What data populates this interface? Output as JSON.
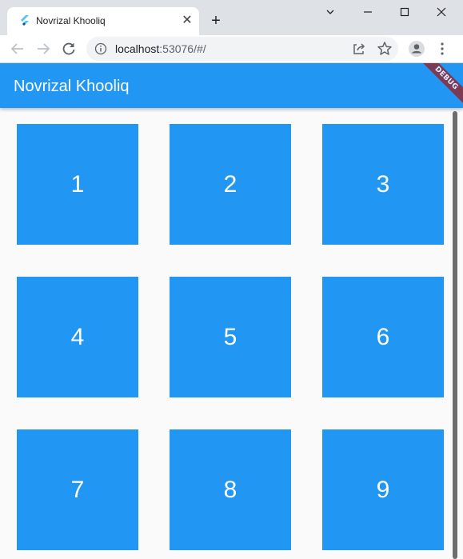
{
  "browser": {
    "tab_title": "Novrizal Khooliq",
    "url_host": "localhost",
    "url_rest": ":53076/#/"
  },
  "app": {
    "title": "Novrizal Khooliq",
    "debug_label": "DEBUG",
    "accent_color": "#2196f3",
    "grid_items": [
      "1",
      "2",
      "3",
      "4",
      "5",
      "6",
      "7",
      "8",
      "9"
    ]
  }
}
